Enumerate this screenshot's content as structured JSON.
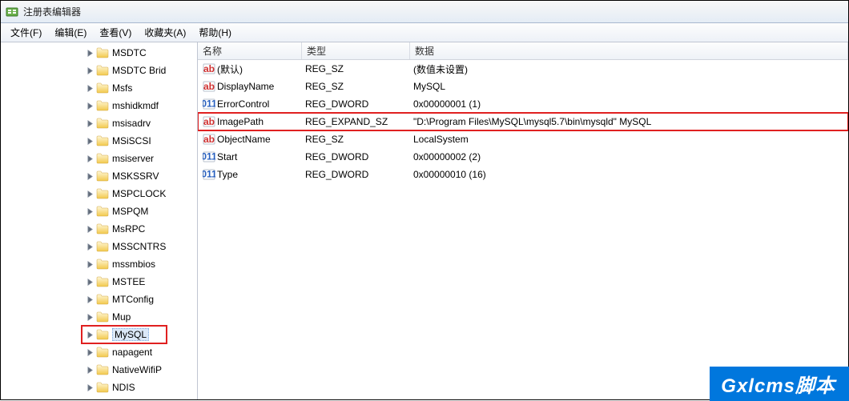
{
  "window": {
    "title": "注册表编辑器"
  },
  "menu": {
    "file": "文件(F)",
    "edit": "编辑(E)",
    "view": "查看(V)",
    "favorites": "收藏夹(A)",
    "help": "帮助(H)"
  },
  "tree": {
    "items": [
      {
        "label": "MSDTC",
        "expanded": false
      },
      {
        "label": "MSDTC Brid",
        "expanded": false
      },
      {
        "label": "Msfs",
        "expanded": false
      },
      {
        "label": "mshidkmdf",
        "expanded": false
      },
      {
        "label": "msisadrv",
        "expanded": false
      },
      {
        "label": "MSiSCSI",
        "expanded": false
      },
      {
        "label": "msiserver",
        "expanded": false
      },
      {
        "label": "MSKSSRV",
        "expanded": false
      },
      {
        "label": "MSPCLOCK",
        "expanded": false
      },
      {
        "label": "MSPQM",
        "expanded": false
      },
      {
        "label": "MsRPC",
        "expanded": false
      },
      {
        "label": "MSSCNTRS",
        "expanded": false
      },
      {
        "label": "mssmbios",
        "expanded": false
      },
      {
        "label": "MSTEE",
        "expanded": false
      },
      {
        "label": "MTConfig",
        "expanded": false
      },
      {
        "label": "Mup",
        "expanded": false
      },
      {
        "label": "MySQL",
        "expanded": false,
        "selected": true,
        "highlight": true
      },
      {
        "label": "napagent",
        "expanded": false
      },
      {
        "label": "NativeWifiP",
        "expanded": false
      },
      {
        "label": "NDIS",
        "expanded": false
      }
    ]
  },
  "list": {
    "headers": {
      "name": "名称",
      "type": "类型",
      "data": "数据"
    },
    "rows": [
      {
        "kind": "str",
        "name": "(默认)",
        "type": "REG_SZ",
        "data": "(数值未设置)"
      },
      {
        "kind": "str",
        "name": "DisplayName",
        "type": "REG_SZ",
        "data": "MySQL"
      },
      {
        "kind": "dword",
        "name": "ErrorControl",
        "type": "REG_DWORD",
        "data": "0x00000001 (1)"
      },
      {
        "kind": "str",
        "name": "ImagePath",
        "type": "REG_EXPAND_SZ",
        "data": "\"D:\\Program Files\\MySQL\\mysql5.7\\bin\\mysqld\" MySQL",
        "highlight": true
      },
      {
        "kind": "str",
        "name": "ObjectName",
        "type": "REG_SZ",
        "data": "LocalSystem"
      },
      {
        "kind": "dword",
        "name": "Start",
        "type": "REG_DWORD",
        "data": "0x00000002 (2)"
      },
      {
        "kind": "dword",
        "name": "Type",
        "type": "REG_DWORD",
        "data": "0x00000010 (16)"
      }
    ]
  },
  "watermark": "Gxlcms脚本"
}
